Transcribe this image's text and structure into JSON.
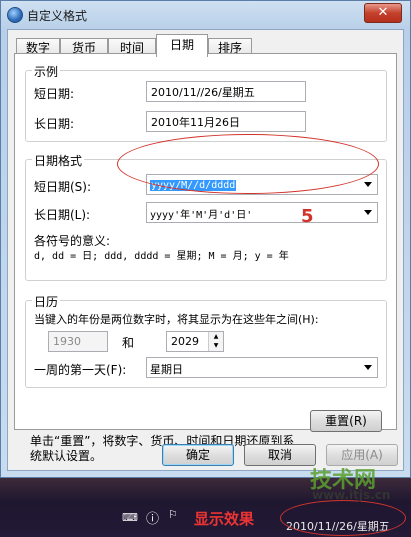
{
  "window": {
    "title": "自定义格式",
    "close_glyph": "✕"
  },
  "tabs": [
    {
      "label": "数字"
    },
    {
      "label": "货币"
    },
    {
      "label": "时间"
    },
    {
      "label": "日期"
    },
    {
      "label": "排序"
    }
  ],
  "example": {
    "group_label": "示例",
    "short_label": "短日期:",
    "short_value": "2010/11//26/星期五",
    "long_label": "长日期:",
    "long_value": "2010年11月26日"
  },
  "date_format": {
    "group_label": "日期格式",
    "short_label": "短日期(S):",
    "short_value": "yyyy/M//d/dddd",
    "long_label": "长日期(L):",
    "long_value": "yyyy'年'M'月'd'日'",
    "meaning_label": "各符号的意义:",
    "meaning_text": "d, dd = 日;  ddd, dddd = 星期;  M = 月;  y = 年",
    "annotation_number": "5"
  },
  "calendar": {
    "group_label": "日历",
    "two_digit_text": "当键入的年份是两位数字时，将其显示为在这些年之间(H):",
    "year_from": "1930",
    "and_label": "和",
    "year_to": "2029",
    "first_day_label": "一周的第一天(F):",
    "first_day_value": "星期日"
  },
  "footer": {
    "reset_text": "单击“重置”，将数字、货币、时间和日期还原到系统默认设置。",
    "reset_button": "重置(R)"
  },
  "buttons": {
    "ok": "确定",
    "cancel": "取消",
    "apply": "应用(A)"
  },
  "taskbar": {
    "annotation": "显示效果",
    "clock": "2010/11//26/星期五"
  },
  "watermark": {
    "brand": "技术网",
    "url": "www.itjs.cn"
  }
}
